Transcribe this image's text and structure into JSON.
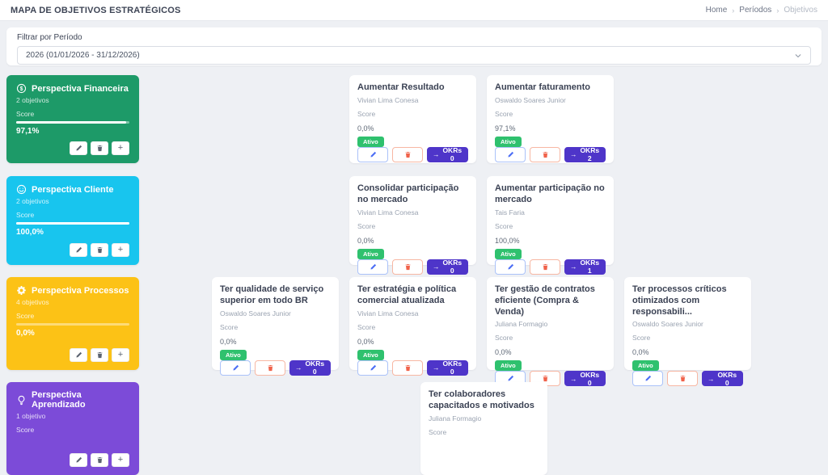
{
  "header": {
    "title": "MAPA DE OBJETIVOS ESTRATÉGICOS"
  },
  "breadcrumb": {
    "separator": "›",
    "items": [
      {
        "label": "Home",
        "current": false
      },
      {
        "label": "Períodos",
        "current": false
      },
      {
        "label": "Objetivos",
        "current": true
      }
    ]
  },
  "filter": {
    "label": "Filtrar por Período",
    "selected": "2026 (01/01/2026 - 31/12/2026)"
  },
  "labels": {
    "score": "Score",
    "okr_arrow": "→"
  },
  "colors": {
    "badge_green": "#2fc16e",
    "okr_purple": "#4e35c9",
    "edit_blue": "#4c6ef5",
    "delete_red": "#f0624a"
  },
  "perspectives": [
    {
      "name": "Perspectiva Financeira",
      "icon": "dollar-circle-icon",
      "color": "#1d9a68",
      "objective_count_label": "2 objetivos",
      "score": "97,1%",
      "score_value": 97.1,
      "objectives": [
        {
          "title": "Aumentar Resultado",
          "owner": "Vivian Lima Conesa",
          "score": "0,0%",
          "score_value": 0,
          "status": "Ativo",
          "okrs": "OKRs 0"
        },
        {
          "title": "Aumentar faturamento",
          "owner": "Oswaldo Soares Junior",
          "score": "97,1%",
          "score_value": 97.1,
          "status": "Ativo",
          "okrs": "OKRs 2"
        }
      ]
    },
    {
      "name": "Perspectiva Cliente",
      "icon": "smiley-icon",
      "color": "#18c5ee",
      "objective_count_label": "2 objetivos",
      "score": "100,0%",
      "score_value": 100,
      "objectives": [
        {
          "title": "Consolidar participação no mercado",
          "owner": "Vivian Lima Conesa",
          "score": "0,0%",
          "score_value": 0,
          "status": "Ativo",
          "okrs": "OKRs 0"
        },
        {
          "title": "Aumentar participação no mercado",
          "owner": "Tais Faria",
          "score": "100,0%",
          "score_value": 100,
          "status": "Ativo",
          "okrs": "OKRs 1"
        }
      ]
    },
    {
      "name": "Perspectiva Processos",
      "icon": "gear-icon",
      "color": "#fcc216",
      "objective_count_label": "4 objetivos",
      "score": "0,0%",
      "score_value": 0,
      "objectives": [
        {
          "title": "Ter qualidade de serviço superior em todo BR",
          "owner": "Oswaldo Soares Junior",
          "score": "0,0%",
          "score_value": 0,
          "status": "Ativo",
          "okrs": "OKRs 0"
        },
        {
          "title": "Ter estratégia e política comercial atualizada",
          "owner": "Vivian Lima Conesa",
          "score": "0,0%",
          "score_value": 0,
          "status": "Ativo",
          "okrs": "OKRs 0"
        },
        {
          "title": "Ter gestão de contratos eficiente (Compra & Venda)",
          "owner": "Juliana Formagio",
          "score": "0,0%",
          "score_value": 0,
          "status": "Ativo",
          "okrs": "OKRs 0"
        },
        {
          "title": "Ter processos críticos otimizados com responsabili...",
          "owner": "Oswaldo Soares Junior",
          "score": "0,0%",
          "score_value": 0,
          "status": "Ativo",
          "okrs": "OKRs 0"
        }
      ]
    },
    {
      "name": "Perspectiva Aprendizado",
      "icon": "lightbulb-icon",
      "color": "#7c4bd8",
      "objective_count_label": "1 objetivo",
      "score": null,
      "score_value": null,
      "objectives": [
        {
          "title": "Ter colaboradores capacitados e motivados",
          "owner": "Juliana Formagio",
          "score": null,
          "score_value": null,
          "status": null,
          "okrs": null
        }
      ]
    }
  ]
}
